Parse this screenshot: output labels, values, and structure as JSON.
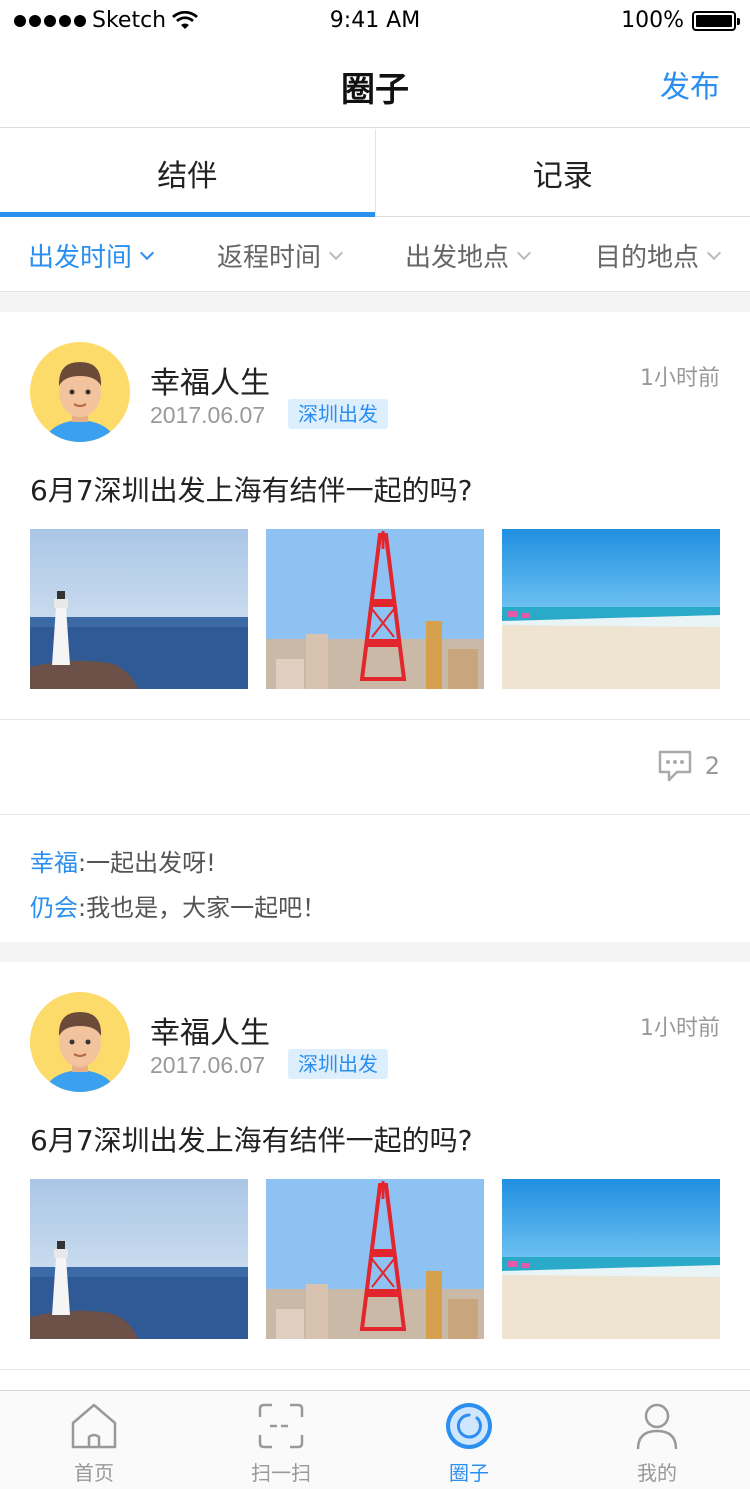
{
  "status": {
    "carrier": "Sketch",
    "time": "9:41 AM",
    "battery": "100%"
  },
  "nav": {
    "title": "圈子",
    "action": "发布"
  },
  "segments": [
    {
      "label": "结伴",
      "active": true
    },
    {
      "label": "记录",
      "active": false
    }
  ],
  "filters": [
    {
      "label": "出发时间",
      "active": true
    },
    {
      "label": "返程时间",
      "active": false
    },
    {
      "label": "出发地点",
      "active": false
    },
    {
      "label": "目的地点",
      "active": false
    }
  ],
  "posts": [
    {
      "user": "幸福人生",
      "date": "2017.06.07",
      "tag": "深圳出发",
      "time": "1小时前",
      "text": "6月7深圳出发上海有结伴一起的吗?",
      "comment_count": "2",
      "comments": [
        {
          "user": "幸福",
          "text": ":一起出发呀!"
        },
        {
          "user": "仍会",
          "text": ":我也是，大家一起吧！"
        }
      ]
    },
    {
      "user": "幸福人生",
      "date": "2017.06.07",
      "tag": "深圳出发",
      "time": "1小时前",
      "text": "6月7深圳出发上海有结伴一起的吗?"
    }
  ],
  "tabbar": [
    {
      "label": "首页",
      "icon": "home-icon",
      "active": false
    },
    {
      "label": "扫一扫",
      "icon": "scan-icon",
      "active": false
    },
    {
      "label": "圈子",
      "icon": "circle-icon",
      "active": true
    },
    {
      "label": "我的",
      "icon": "profile-icon",
      "active": false
    }
  ],
  "colors": {
    "accent": "#2b8ff0",
    "tag_bg": "#ddeefd",
    "avatar_bg": "#fddb6a"
  }
}
